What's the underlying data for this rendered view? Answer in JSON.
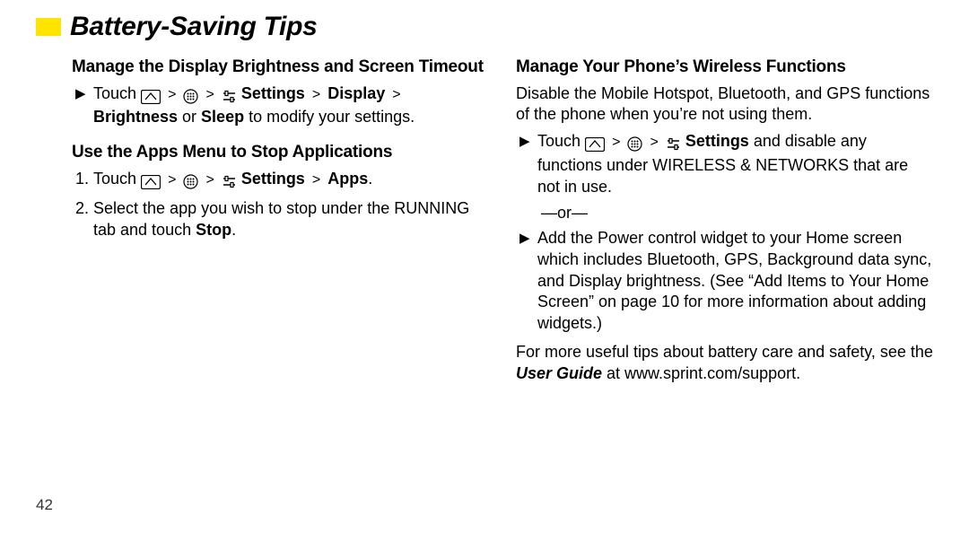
{
  "title": "Battery-Saving Tips",
  "page_number": "42",
  "left": {
    "h1": "Manage the Display Brightness and Screen Timeout",
    "s1_pre": "Touch ",
    "s1_mid": "Settings",
    "s1_mid2": "Display",
    "s1_tail1": "Brightness",
    "s1_tail_or": " or ",
    "s1_tail2": "Sleep",
    "s1_end": " to modify your settings.",
    "h2": "Use the Apps Menu to Stop Applications",
    "s2_num": "1.",
    "s2_pre": "Touch ",
    "s2_mid": "Settings",
    "s2_mid2": "Apps",
    "s2_end": ".",
    "s3_num": "2.",
    "s3_a": "Select the app you wish to stop under the RUNNING tab and touch ",
    "s3_b": "Stop",
    "s3_c": "."
  },
  "right": {
    "h1": "Manage Your Phone’s Wireless Functions",
    "p1": "Disable the Mobile Hotspot, Bluetooth, and GPS functions of the phone when you’re not using them.",
    "s1_pre": "Touch ",
    "s1_mid": "Settings",
    "s1_tail": " and disable any functions under WIRELESS & NETWORKS that are not in use.",
    "or": "—or—",
    "s2": "Add the Power control widget to your Home screen which includes Bluetooth, GPS, Background data sync, and Display brightness. (See “Add Items to Your Home Screen” on page 10 for more information about adding widgets.)",
    "p2a": "For more useful tips about battery care and safety, see the ",
    "p2b": "User Guide",
    "p2c": " at www.sprint.com/support."
  }
}
